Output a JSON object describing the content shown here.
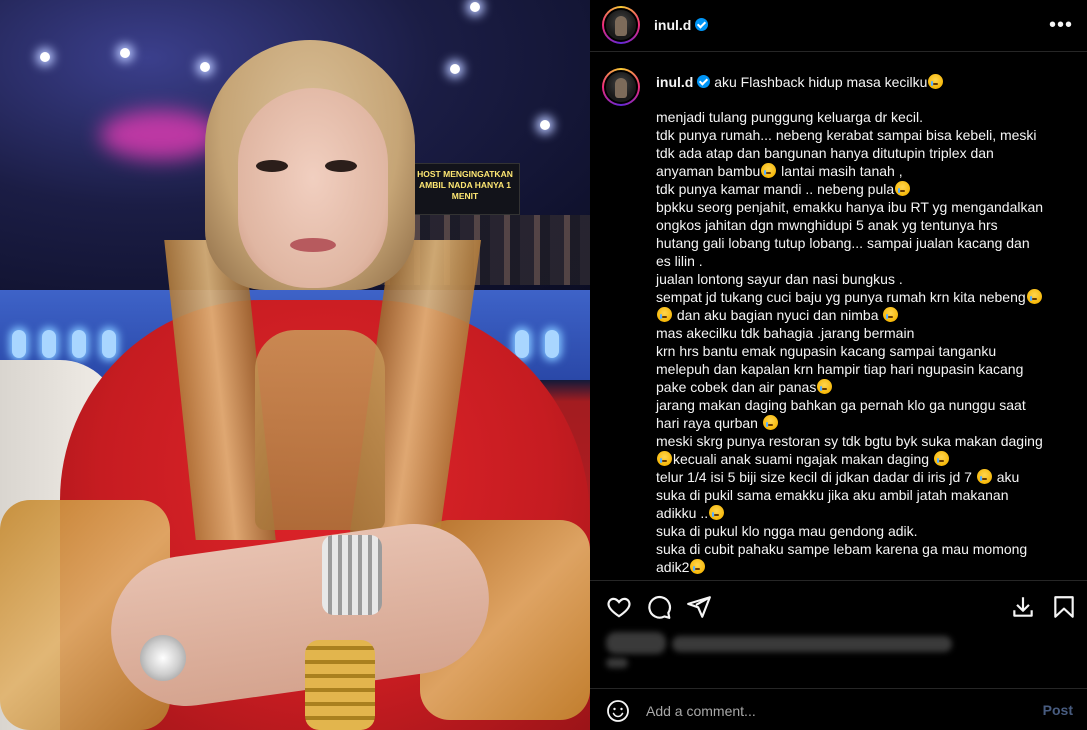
{
  "post": {
    "username": "inul.d",
    "verified": true,
    "caption_title": "aku Flashback hidup masa kecilku",
    "caption_lines": [
      "menjadi tulang punggung keluarga dr kecil.",
      "tdk punya rumah... nebeng kerabat sampai bisa kebeli, meski",
      "tdk ada atap dan bangunan hanya ditutupin triplex dan",
      "anyaman bambu",
      "tdk punya kamar mandi .. nebeng pula",
      "bpkku seorg penjahit, emakku hanya ibu RT yg mengandalkan",
      "ongkos jahitan dgn mwnghidupi 5 anak yg tentunya hrs",
      "hutang gali lobang tutup lobang... sampai jualan kacang dan",
      "es lilin .",
      "jualan lontong sayur dan nasi bungkus .",
      "sempat jd tukang cuci baju yg punya rumah krn kita nebeng",
      " dan aku bagian nyuci dan nimba ",
      "mas akecilku tdk bahagia .jarang bermain",
      "krn hrs bantu emak ngupasin kacang sampai tanganku",
      "melepuh dan kapalan krn hampir tiap hari ngupasin kacang",
      "pake cobek dan air panas",
      "jarang makan daging bahkan ga pernah klo ga nunggu saat",
      "hari raya qurban ",
      "meski skrg punya restoran sy tdk bgtu byk suka makan daging",
      "kecuali anak suami ngajak makan daging ",
      "telur 1/4 isi 5 biji size kecil di jdkan dadar di iris jd 7  aku",
      "suka di pukil sama emakku jika aku ambil jatah makanan",
      "adikku ..",
      "suka di pukul klo ngga mau gendong adik.",
      "suka di cubit pahaku sampe lebam karena ga mau momong",
      "adik2"
    ],
    "anyaman_suffix": " lantai masih tanah ,"
  },
  "photo": {
    "sign_text": "HOST MENGINGATKAN AMBIL NADA HANYA 1 MENIT"
  },
  "header": {
    "more_icon": "more-horizontal-icon",
    "more_label": "•••"
  },
  "comment": {
    "placeholder": "Add a comment...",
    "post_label": "Post"
  },
  "icons": [
    "heart-icon",
    "comment-icon",
    "share-icon",
    "download-icon",
    "bookmark-icon",
    "smile-icon",
    "verified-icon"
  ],
  "colors": {
    "background": "#000000",
    "text": "#f5f5f5",
    "verified": "#0095f6",
    "post_disabled": "#485c80",
    "divider": "#262626"
  }
}
